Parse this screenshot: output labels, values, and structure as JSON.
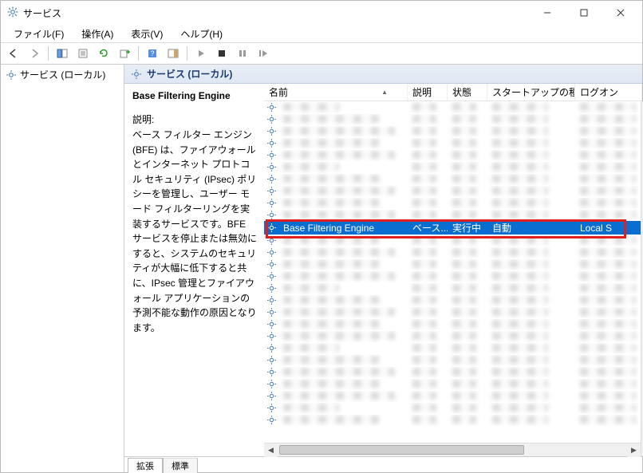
{
  "window": {
    "title": "サービス"
  },
  "menubar": {
    "file": "ファイル(F)",
    "action": "操作(A)",
    "view": "表示(V)",
    "help": "ヘルプ(H)"
  },
  "tree": {
    "root": "サービス (ローカル)"
  },
  "right_header": "サービス (ローカル)",
  "detail": {
    "title": "Base Filtering Engine",
    "label": "説明:",
    "description": "ベース フィルター エンジン (BFE) は、ファイアウォールとインターネット プロトコル セキュリティ (IPsec) ポリシーを管理し、ユーザー モード フィルターリングを実装するサービスです。BFE サービスを停止または無効にすると、システムのセキュリティが大幅に低下すると共に、IPsec 管理とファイアウォール アプリケーションの予測不能な動作の原因となります。"
  },
  "columns": {
    "name": "名前",
    "desc": "説明",
    "status": "状態",
    "startup": "スタートアップの種類",
    "logon": "ログオン"
  },
  "selected_service": {
    "name": "Base Filtering Engine",
    "desc": "ベース...",
    "status": "実行中",
    "startup": "自動",
    "logon": "Local S"
  },
  "tabs": {
    "extended": "拡張",
    "standard": "標準"
  }
}
